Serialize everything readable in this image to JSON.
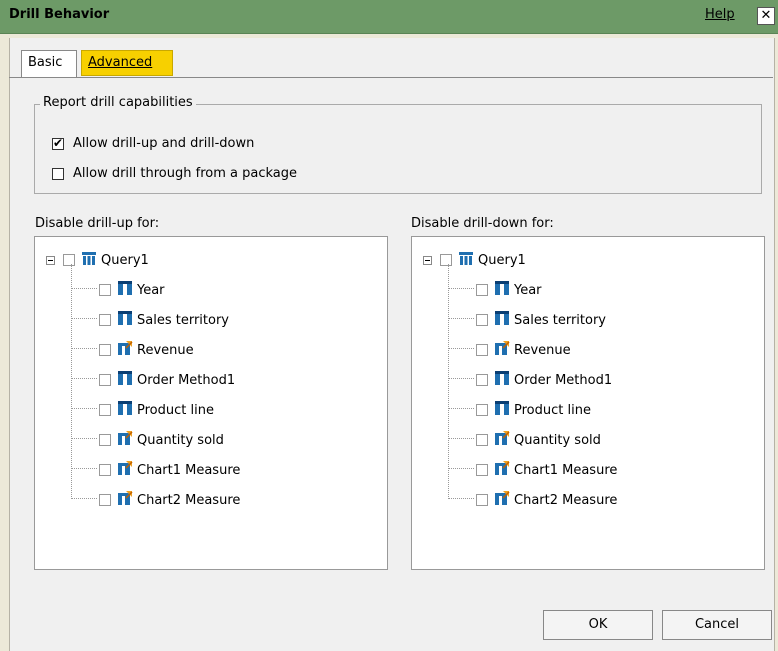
{
  "dialog": {
    "title": "Drill Behavior",
    "help_label": "Help",
    "close_label": "✕"
  },
  "tabs": [
    {
      "label": "Basic",
      "selected": true
    },
    {
      "label": "Advanced",
      "selected": false
    }
  ],
  "capabilities": {
    "legend": "Report drill capabilities",
    "options": [
      {
        "label": "Allow drill-up and drill-down",
        "checked": true
      },
      {
        "label": "Allow drill through from a package",
        "checked": false
      }
    ]
  },
  "drill_up": {
    "label": "Disable drill-up for:",
    "root": "Query1",
    "items": [
      {
        "label": "Year",
        "icon": "level-icon"
      },
      {
        "label": "Sales territory",
        "icon": "level-icon"
      },
      {
        "label": "Revenue",
        "icon": "measure-icon"
      },
      {
        "label": "Order Method1",
        "icon": "level-icon"
      },
      {
        "label": "Product line",
        "icon": "level-icon"
      },
      {
        "label": "Quantity sold",
        "icon": "measure-icon"
      },
      {
        "label": "Chart1 Measure",
        "icon": "measure-icon"
      },
      {
        "label": "Chart2 Measure",
        "icon": "measure-icon"
      }
    ]
  },
  "drill_down": {
    "label": "Disable drill-down for:",
    "root": "Query1",
    "items": [
      {
        "label": "Year",
        "icon": "level-icon"
      },
      {
        "label": "Sales territory",
        "icon": "level-icon"
      },
      {
        "label": "Revenue",
        "icon": "measure-icon"
      },
      {
        "label": "Order Method1",
        "icon": "level-icon"
      },
      {
        "label": "Product line",
        "icon": "level-icon"
      },
      {
        "label": "Quantity sold",
        "icon": "measure-icon"
      },
      {
        "label": "Chart1 Measure",
        "icon": "measure-icon"
      },
      {
        "label": "Chart2 Measure",
        "icon": "measure-icon"
      }
    ]
  },
  "buttons": {
    "ok": "OK",
    "cancel": "Cancel"
  },
  "colors": {
    "titlebar": "#6d9a67",
    "advanced_tab": "#f7d000"
  }
}
